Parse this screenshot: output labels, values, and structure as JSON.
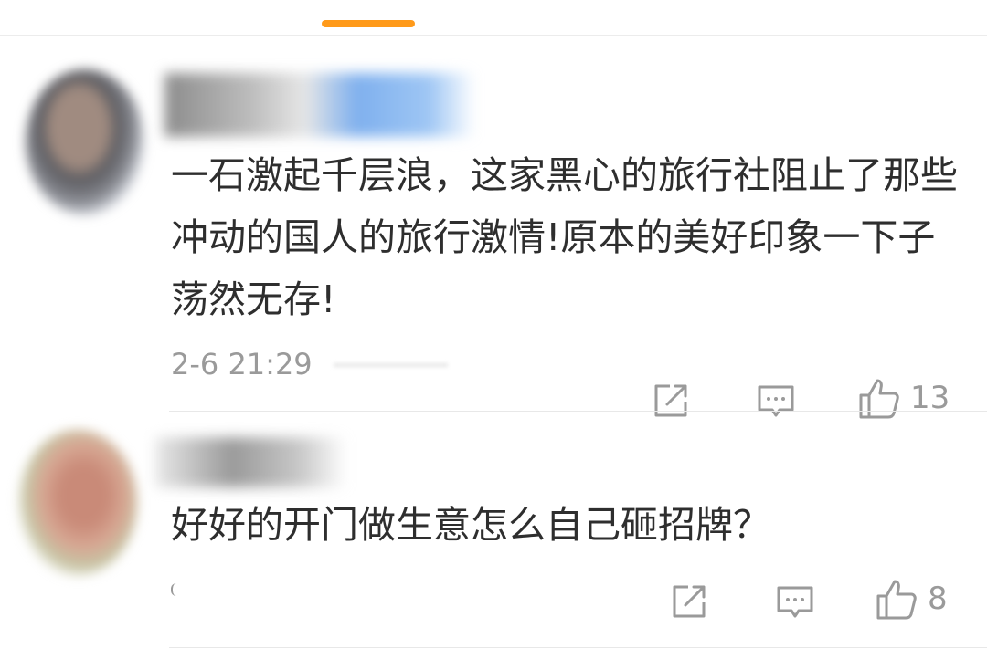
{
  "icons": {
    "share": "share-icon",
    "reply": "comment-bubble-icon",
    "like": "thumbs-up-icon"
  },
  "colors": {
    "tab_indicator": "#ff9a1a",
    "text": "#2e2e2e",
    "meta": "#9a9a9a"
  },
  "comments": [
    {
      "text": "一石激起千层浪，这家黑心的旅行社阻止了那些冲动的国人的旅行激情!原本的美好印象一下子荡然无存!",
      "time": "2-6 21:29",
      "likes": "13"
    },
    {
      "text": "好好的开门做生意怎么自己砸招牌？",
      "likes": "8"
    }
  ]
}
